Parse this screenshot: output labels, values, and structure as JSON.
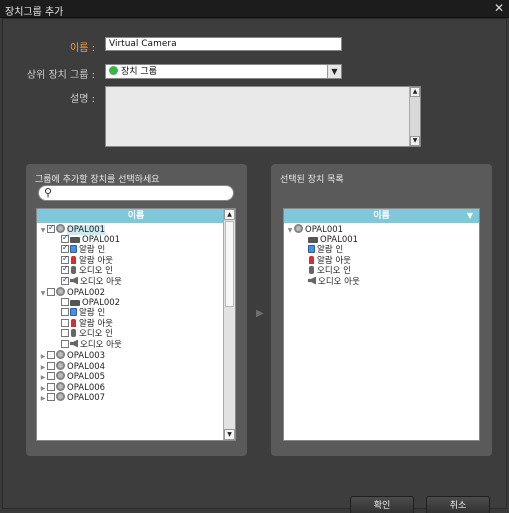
{
  "window": {
    "title": "장치그룹 추가",
    "close_glyph": "✕"
  },
  "form": {
    "name_label": "이름 :",
    "name_value": "Virtual Camera",
    "parent_label": "상위 장치 그룹 :",
    "parent_value": "장치 그룹",
    "description_label": "설명 :",
    "description_value": ""
  },
  "left_panel": {
    "title": "그룹에 추가할 장치를 선택하세요",
    "search_placeholder": "",
    "column_header": "이름",
    "rows": [
      {
        "level": 1,
        "expand": "▼",
        "checked": true,
        "icon": "device-icon",
        "label": "OPAL001",
        "selected": true
      },
      {
        "level": 2,
        "expand": "",
        "checked": true,
        "icon": "camera-icon",
        "label": "OPAL001"
      },
      {
        "level": 2,
        "expand": "",
        "checked": true,
        "icon": "alarm-in-icon",
        "label": "알람 인"
      },
      {
        "level": 2,
        "expand": "",
        "checked": true,
        "icon": "alarm-out-icon",
        "label": "알람 아웃"
      },
      {
        "level": 2,
        "expand": "",
        "checked": true,
        "icon": "audio-in-icon",
        "label": "오디오 인"
      },
      {
        "level": 2,
        "expand": "",
        "checked": true,
        "icon": "audio-out-icon",
        "label": "오디오 아웃"
      },
      {
        "level": 1,
        "expand": "▼",
        "checked": false,
        "icon": "device-icon",
        "label": "OPAL002"
      },
      {
        "level": 2,
        "expand": "",
        "checked": false,
        "icon": "camera-icon",
        "label": "OPAL002"
      },
      {
        "level": 2,
        "expand": "",
        "checked": false,
        "icon": "alarm-in-icon",
        "label": "알람 인"
      },
      {
        "level": 2,
        "expand": "",
        "checked": false,
        "icon": "alarm-out-icon",
        "label": "알람 아웃"
      },
      {
        "level": 2,
        "expand": "",
        "checked": false,
        "icon": "audio-in-icon",
        "label": "오디오 인"
      },
      {
        "level": 2,
        "expand": "",
        "checked": false,
        "icon": "audio-out-icon",
        "label": "오디오 아웃"
      },
      {
        "level": 1,
        "expand": "▶",
        "checked": false,
        "icon": "device-icon",
        "label": "OPAL003"
      },
      {
        "level": 1,
        "expand": "▶",
        "checked": false,
        "icon": "device-icon",
        "label": "OPAL004"
      },
      {
        "level": 1,
        "expand": "▶",
        "checked": false,
        "icon": "device-icon",
        "label": "OPAL005"
      },
      {
        "level": 1,
        "expand": "▶",
        "checked": false,
        "icon": "device-icon",
        "label": "OPAL006"
      },
      {
        "level": 1,
        "expand": "▶",
        "checked": false,
        "icon": "device-icon",
        "label": "OPAL007"
      }
    ]
  },
  "right_panel": {
    "title": "선택된 장치 목록",
    "column_header": "이름",
    "rows": [
      {
        "level": 1,
        "expand": "▼",
        "icon": "device-icon",
        "label": "OPAL001"
      },
      {
        "level": 2,
        "expand": "",
        "icon": "camera-icon",
        "label": "OPAL001"
      },
      {
        "level": 2,
        "expand": "",
        "icon": "alarm-in-icon",
        "label": "알람 인"
      },
      {
        "level": 2,
        "expand": "",
        "icon": "alarm-out-icon",
        "label": "알람 아웃"
      },
      {
        "level": 2,
        "expand": "",
        "icon": "audio-in-icon",
        "label": "오디오 인"
      },
      {
        "level": 2,
        "expand": "",
        "icon": "audio-out-icon",
        "label": "오디오 아웃"
      }
    ]
  },
  "buttons": {
    "ok": "확인",
    "cancel": "취소"
  },
  "colors": {
    "accent_label": "#f2a33a",
    "header_blue": "#7fc7d9",
    "panel": "#5a5a5a",
    "background": "#3d3d3d"
  }
}
